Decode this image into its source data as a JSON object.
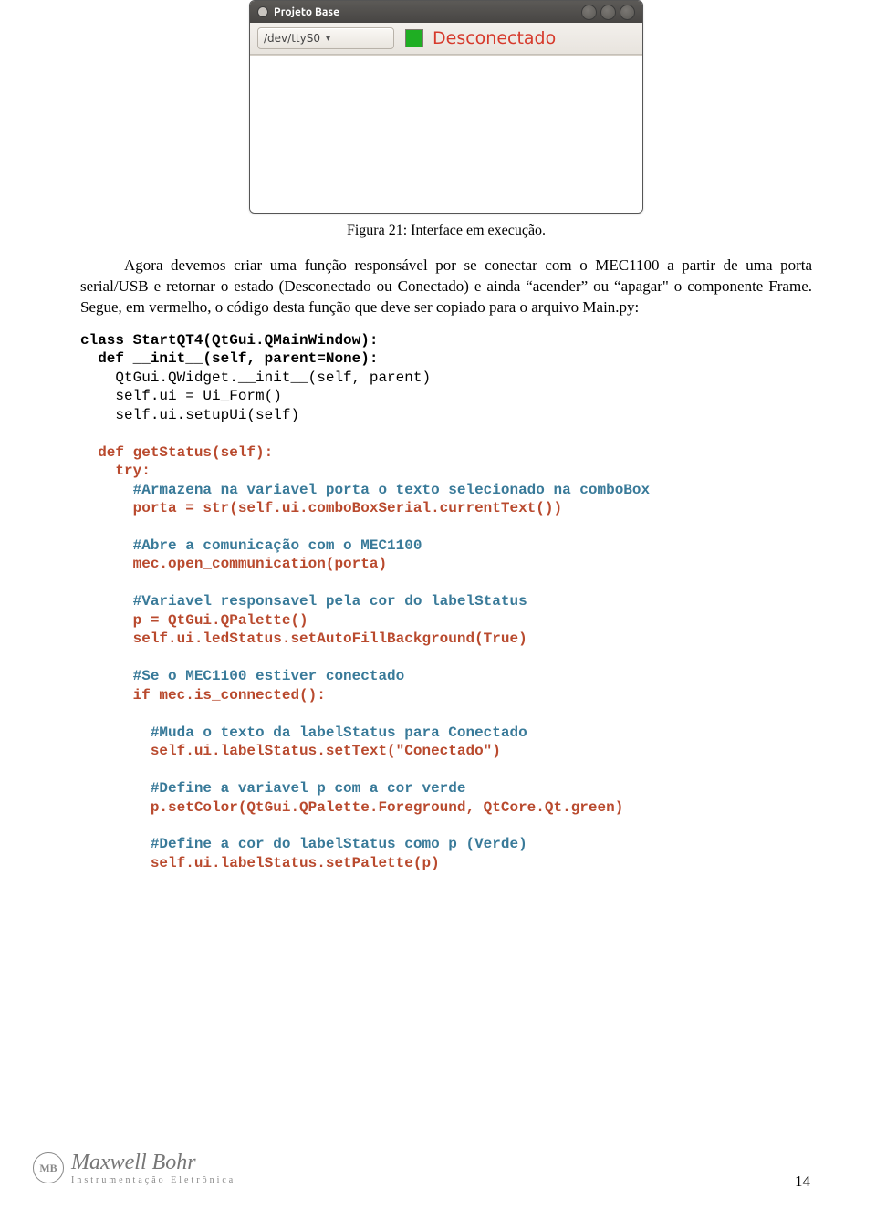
{
  "app": {
    "title": "Projeto Base",
    "combo_value": "/dev/ttyS0",
    "status_text": "Desconectado",
    "led_color": "#1fae23",
    "status_color": "#d63a2c"
  },
  "caption": "Figura 21: Interface em execução.",
  "paragraph": "Agora devemos criar uma função responsável por se conectar com o MEC1100 a partir de uma porta serial/USB e retornar o estado (Desconectado ou Conectado) e ainda “acender” ou “apagar\" o componente Frame. Segue, em vermelho, o código desta função que deve ser copiado para o arquivo Main.py:",
  "code": {
    "lines": [
      {
        "t": "kw",
        "txt": "class StartQT4(QtGui.QMainWindow):"
      },
      {
        "t": "kw",
        "txt": "  def __init__(self, parent=None):"
      },
      {
        "t": "pl",
        "txt": "    QtGui.QWidget.__init__(self, parent)"
      },
      {
        "t": "pl",
        "txt": "    self.ui = Ui_Form()"
      },
      {
        "t": "pl",
        "txt": "    self.ui.setupUi(self)"
      },
      {
        "t": "blank",
        "txt": ""
      },
      {
        "t": "hl",
        "txt": "  def getStatus(self):"
      },
      {
        "t": "hl",
        "txt": "    try:"
      },
      {
        "t": "cmt",
        "txt": "      #Armazena na variavel porta o texto selecionado na comboBox"
      },
      {
        "t": "hl",
        "txt": "      porta = str(self.ui.comboBoxSerial.currentText())"
      },
      {
        "t": "blank",
        "txt": ""
      },
      {
        "t": "cmt",
        "txt": "      #Abre a comunicação com o MEC1100"
      },
      {
        "t": "hl",
        "txt": "      mec.open_communication(porta)"
      },
      {
        "t": "blank",
        "txt": ""
      },
      {
        "t": "cmt",
        "txt": "      #Variavel responsavel pela cor do labelStatus"
      },
      {
        "t": "hl",
        "txt": "      p = QtGui.QPalette()"
      },
      {
        "t": "hl",
        "txt": "      self.ui.ledStatus.setAutoFillBackground(True)"
      },
      {
        "t": "blank",
        "txt": ""
      },
      {
        "t": "cmt",
        "txt": "      #Se o MEC1100 estiver conectado"
      },
      {
        "t": "hl",
        "txt": "      if mec.is_connected():"
      },
      {
        "t": "blank",
        "txt": ""
      },
      {
        "t": "cmt",
        "txt": "        #Muda o texto da labelStatus para Conectado"
      },
      {
        "t": "hl",
        "txt": "        self.ui.labelStatus.setText(\"Conectado\")"
      },
      {
        "t": "blank",
        "txt": ""
      },
      {
        "t": "cmt",
        "txt": "        #Define a variavel p com a cor verde"
      },
      {
        "t": "hl",
        "txt": "        p.setColor(QtGui.QPalette.Foreground, QtCore.Qt.green)"
      },
      {
        "t": "blank",
        "txt": ""
      },
      {
        "t": "cmt",
        "txt": "        #Define a cor do labelStatus como p (Verde)"
      },
      {
        "t": "hl",
        "txt": "        self.ui.labelStatus.setPalette(p)"
      }
    ]
  },
  "footer": {
    "brand_line1": "Maxwell Bohr",
    "brand_line2": "Instrumentação Eletrônica",
    "badge_text": "MB"
  },
  "page_number": "14"
}
